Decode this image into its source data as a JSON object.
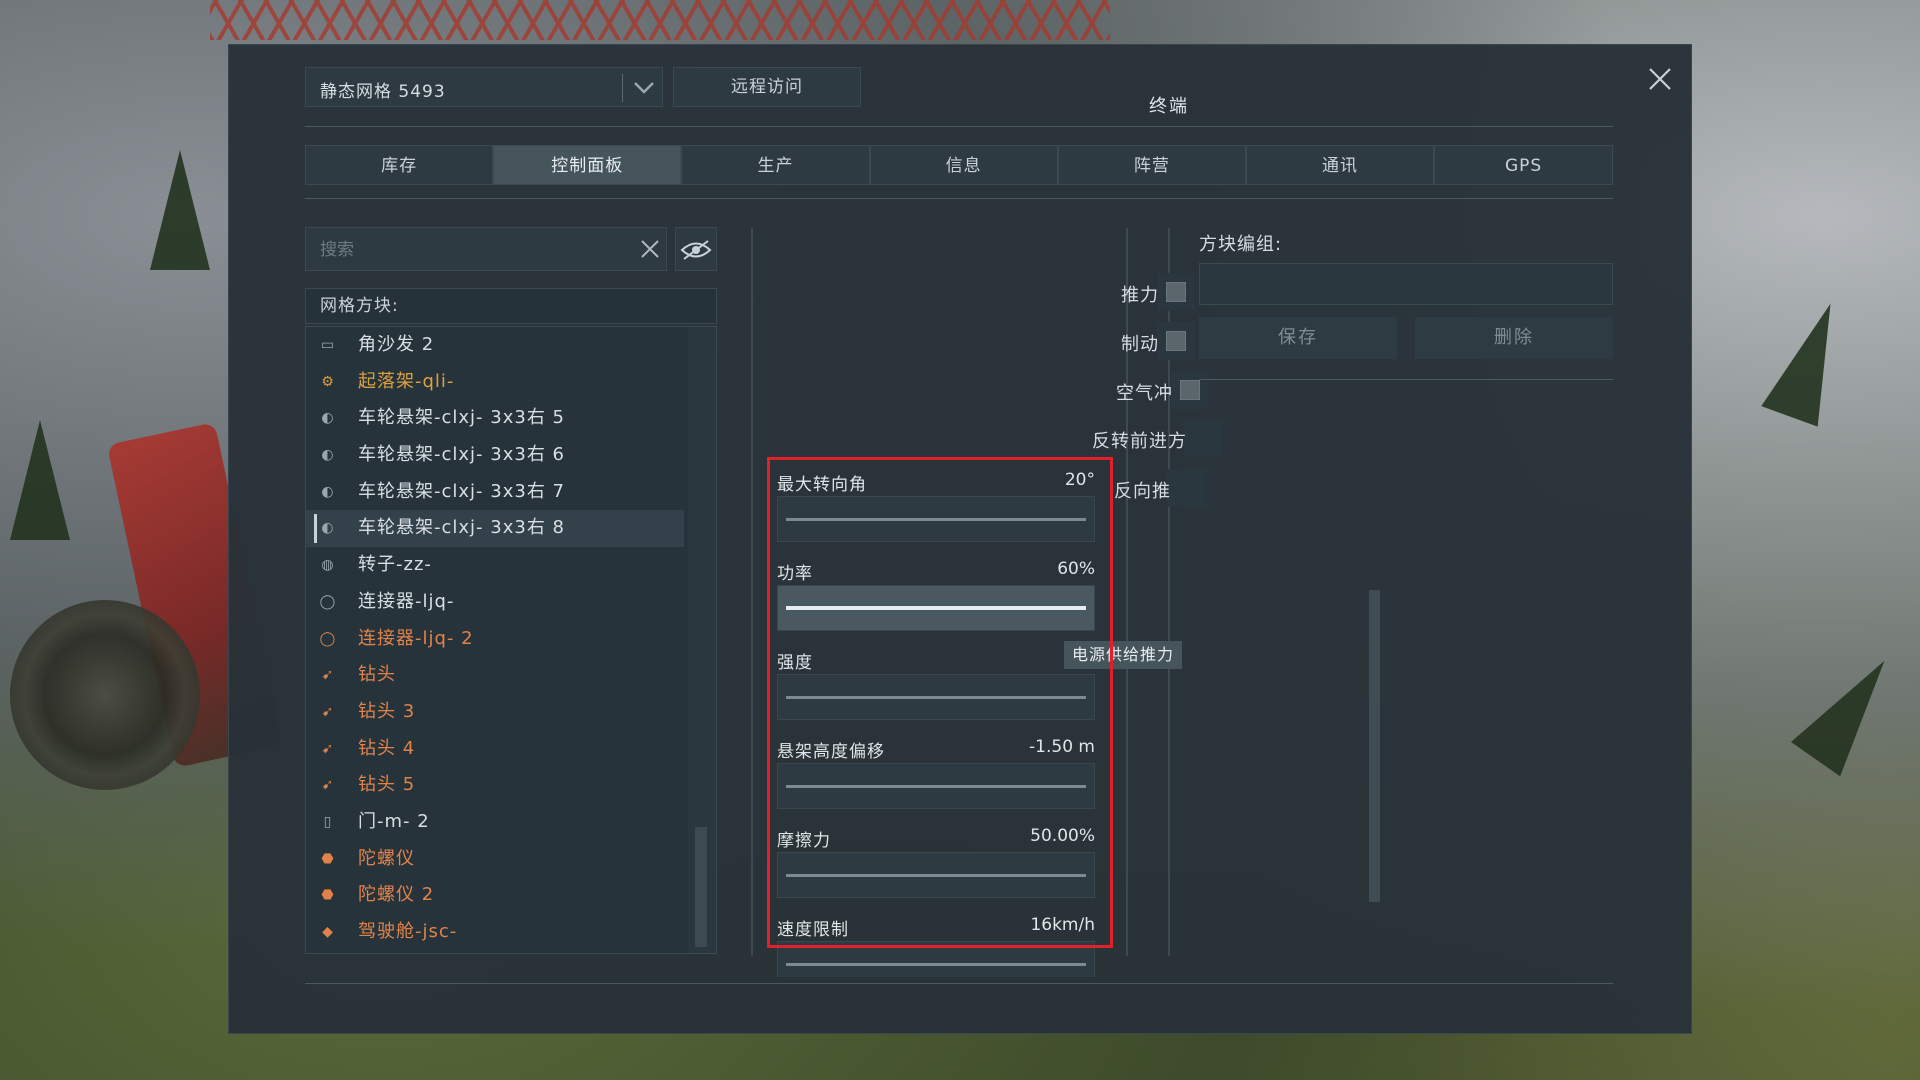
{
  "terminal": {
    "title": "终端",
    "grid_name": "静态网格 5493",
    "remote_access": "远程访问"
  },
  "tabs": [
    {
      "label": "库存"
    },
    {
      "label": "控制面板"
    },
    {
      "label": "生产"
    },
    {
      "label": "信息"
    },
    {
      "label": "阵营"
    },
    {
      "label": "通讯"
    },
    {
      "label": "GPS"
    }
  ],
  "active_tab": "控制面板",
  "search": {
    "placeholder": "搜索"
  },
  "blocks": {
    "header": "网格方块:",
    "items": [
      {
        "label": "角沙发 2",
        "icon": "sofa-icon",
        "color": "#d8dfe3"
      },
      {
        "label": "起落架-qli-",
        "icon": "landing-gear-icon",
        "color": "#d9a040"
      },
      {
        "label": "车轮悬架-clxj- 3x3右 5",
        "icon": "wheel-suspension-icon",
        "color": "#d8dfe3"
      },
      {
        "label": "车轮悬架-clxj- 3x3右 6",
        "icon": "wheel-suspension-icon",
        "color": "#d8dfe3"
      },
      {
        "label": "车轮悬架-clxj- 3x3右 7",
        "icon": "wheel-suspension-icon",
        "color": "#d8dfe3"
      },
      {
        "label": "车轮悬架-clxj- 3x3右 8",
        "icon": "wheel-suspension-icon",
        "color": "#d8dfe3",
        "selected": true
      },
      {
        "label": "转子-zz-",
        "icon": "rotor-icon",
        "color": "#d8dfe3"
      },
      {
        "label": "连接器-ljq-",
        "icon": "connector-icon",
        "color": "#d8dfe3"
      },
      {
        "label": "连接器-ljq- 2",
        "icon": "connector-icon",
        "color": "#e0834a"
      },
      {
        "label": "钻头",
        "icon": "drill-icon",
        "color": "#e0834a"
      },
      {
        "label": "钻头 3",
        "icon": "drill-icon",
        "color": "#e0834a"
      },
      {
        "label": "钻头 4",
        "icon": "drill-icon",
        "color": "#e0834a"
      },
      {
        "label": "钻头 5",
        "icon": "drill-icon",
        "color": "#e0834a"
      },
      {
        "label": "门-m- 2",
        "icon": "door-icon",
        "color": "#d8dfe3"
      },
      {
        "label": "陀螺仪",
        "icon": "gyroscope-icon",
        "color": "#e0834a"
      },
      {
        "label": "陀螺仪 2",
        "icon": "gyroscope-icon",
        "color": "#e0834a"
      },
      {
        "label": "驾驶舱-jsc-",
        "icon": "cockpit-icon",
        "color": "#e0834a"
      }
    ]
  },
  "controls": {
    "toggles": [
      {
        "label": "推力"
      },
      {
        "label": "制动"
      },
      {
        "label": "空气冲"
      },
      {
        "label": "反转前进方"
      },
      {
        "label": "反向推"
      }
    ],
    "sliders": [
      {
        "label": "最大转向角",
        "value": "20°",
        "fraction": 0.5,
        "active": false
      },
      {
        "label": "功率",
        "value": "60%",
        "fraction": 0.6,
        "active": true
      },
      {
        "label": "强度",
        "value": "",
        "fraction": 0.5,
        "active": false
      },
      {
        "label": "悬架高度偏移",
        "value": "-1.50 m",
        "fraction": 0.5,
        "active": false
      },
      {
        "label": "摩擦力",
        "value": "50.00%",
        "fraction": 0.5,
        "active": false
      },
      {
        "label": "速度限制",
        "value": "16km/h",
        "fraction": 0.5,
        "active": false
      }
    ],
    "tooltip": "电源供给推力"
  },
  "block_group": {
    "label": "方块编组:",
    "save": "保存",
    "delete": "删除"
  },
  "highlight_color": "#e0202a"
}
